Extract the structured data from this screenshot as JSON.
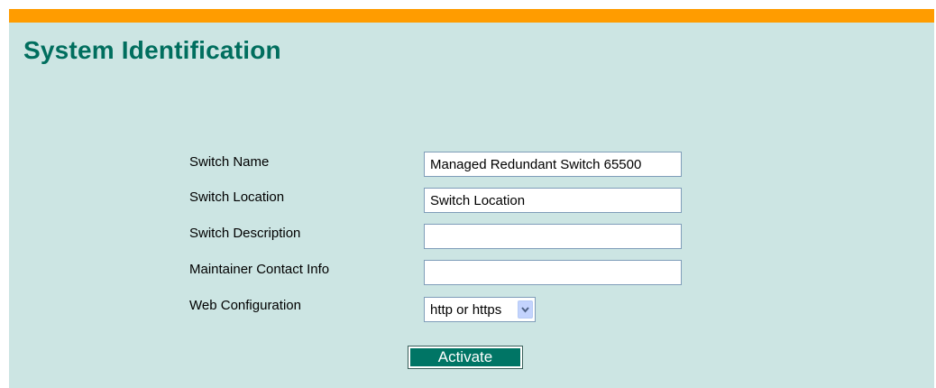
{
  "page": {
    "title": "System Identification",
    "header_bar_color": "#ff9c00",
    "background_color": "#cce5e3",
    "title_color": "#006e5e"
  },
  "form": {
    "switch_name": {
      "label": "Switch Name",
      "value": "Managed Redundant Switch 65500"
    },
    "switch_location": {
      "label": "Switch Location",
      "value": "Switch Location"
    },
    "switch_description": {
      "label": "Switch Description",
      "value": ""
    },
    "maintainer_contact": {
      "label": "Maintainer Contact Info",
      "value": ""
    },
    "web_configuration": {
      "label": "Web Configuration",
      "selected": "http or https",
      "icon": "chevron-down-icon"
    },
    "activate_label": "Activate",
    "activate_color": "#007565"
  }
}
